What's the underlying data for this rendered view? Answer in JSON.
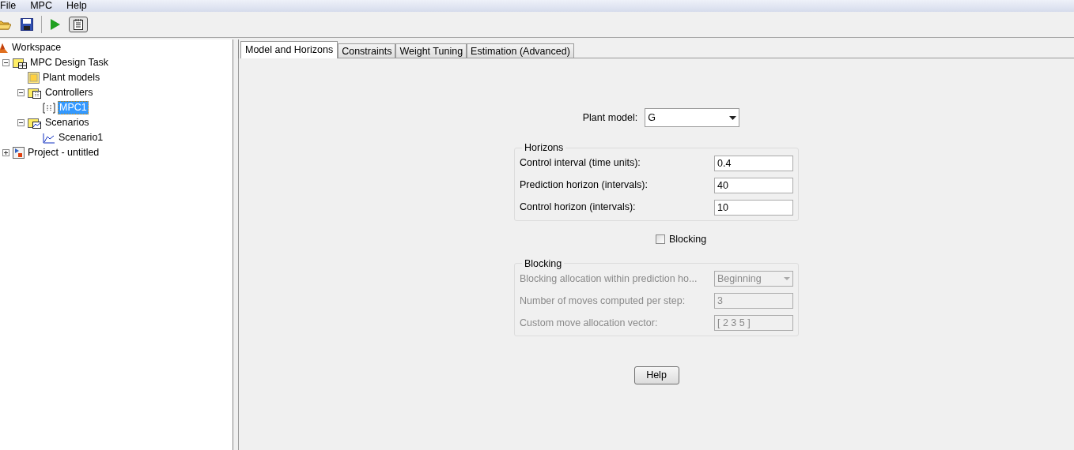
{
  "menu": [
    "File",
    "MPC",
    "Help"
  ],
  "tree": [
    {
      "label": "Workspace",
      "kind": "workspace",
      "selected": false,
      "children": [
        {
          "label": "MPC Design Task",
          "kind": "task",
          "expanded": true,
          "selected": false,
          "children": [
            {
              "label": "Plant models",
              "kind": "plant",
              "selected": false
            },
            {
              "label": "Controllers",
              "kind": "controllers",
              "expanded": true,
              "selected": false,
              "children": [
                {
                  "label": "MPC1",
                  "kind": "controller",
                  "selected": true
                }
              ]
            },
            {
              "label": "Scenarios",
              "kind": "scenarios",
              "expanded": true,
              "selected": false,
              "children": [
                {
                  "label": "Scenario1",
                  "kind": "scenario",
                  "selected": false
                }
              ]
            }
          ]
        },
        {
          "label": "Project - untitled",
          "kind": "project",
          "expanded": false,
          "selected": false
        }
      ]
    }
  ],
  "tabs": [
    {
      "label": "Model and Horizons",
      "selected": true
    },
    {
      "label": "Constraints",
      "selected": false
    },
    {
      "label": "Weight Tuning",
      "selected": false
    },
    {
      "label": "Estimation (Advanced)",
      "selected": false
    }
  ],
  "plant_model": {
    "label": "Plant model:",
    "value": "G"
  },
  "horizons": {
    "title": "Horizons",
    "disabled": false,
    "fields": [
      {
        "label": "Control interval (time units):",
        "value": "0.4",
        "kind": "text"
      },
      {
        "label": "Prediction horizon (intervals):",
        "value": "40",
        "kind": "text"
      },
      {
        "label": "Control horizon (intervals):",
        "value": "10",
        "kind": "text"
      }
    ]
  },
  "blocking_checkbox": {
    "label": "Blocking",
    "checked": false
  },
  "blocking": {
    "title": "Blocking",
    "disabled": true,
    "fields": [
      {
        "label": "Blocking allocation within prediction ho...",
        "value": "Beginning",
        "kind": "select"
      },
      {
        "label": "Number of moves computed per step:",
        "value": "3",
        "kind": "text"
      },
      {
        "label": "Custom move allocation vector:",
        "value": "[ 2 3 5 ]",
        "kind": "text"
      }
    ]
  },
  "help_button": "Help"
}
